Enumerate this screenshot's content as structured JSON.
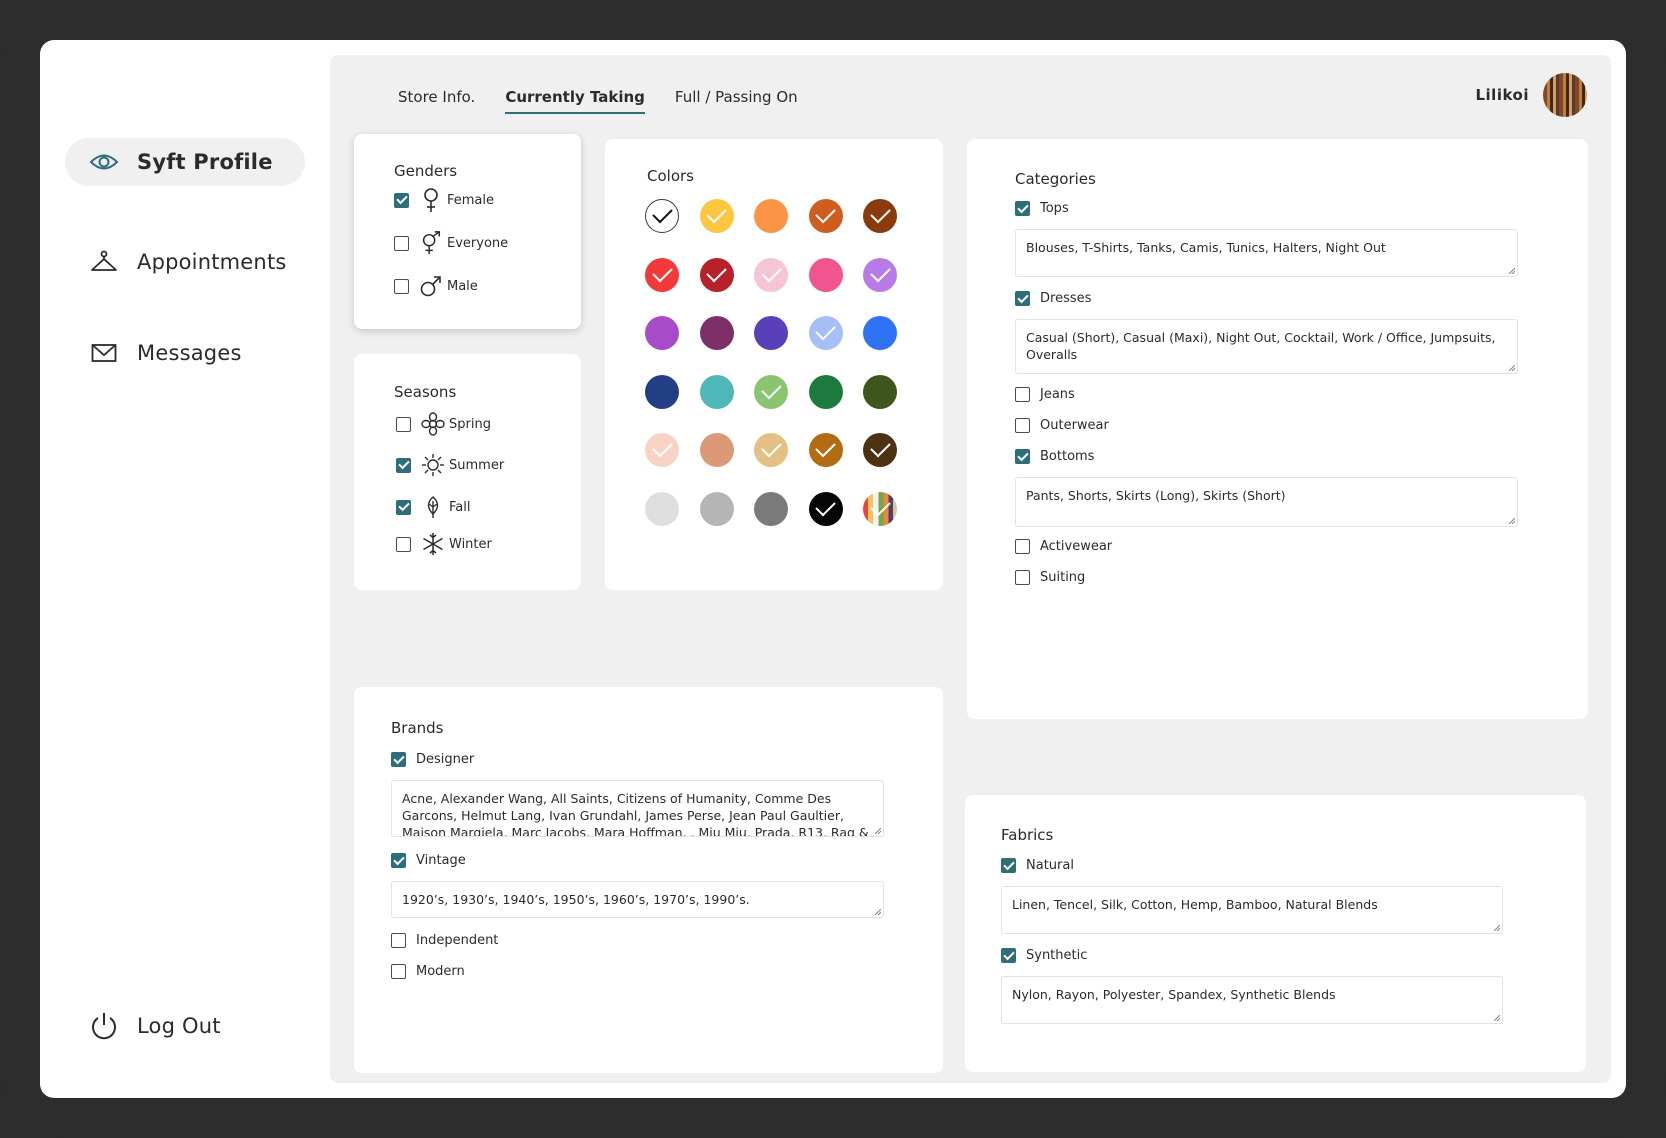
{
  "sidebar": {
    "items": [
      {
        "label": "Syft Profile",
        "icon": "eye-icon",
        "active": true
      },
      {
        "label": "Appointments",
        "icon": "hanger-icon",
        "active": false
      },
      {
        "label": "Messages",
        "icon": "envelope-icon",
        "active": false
      }
    ],
    "logout": {
      "label": "Log Out",
      "icon": "power-icon"
    }
  },
  "tabs": [
    {
      "label": "Store Info.",
      "active": false
    },
    {
      "label": "Currently Taking",
      "active": true
    },
    {
      "label": "Full / Passing On",
      "active": false
    }
  ],
  "user": {
    "name": "Lilikoi"
  },
  "genders": {
    "title": "Genders",
    "items": [
      {
        "label": "Female",
        "icon": "female-symbol-icon",
        "checked": true
      },
      {
        "label": "Everyone",
        "icon": "unisex-symbol-icon",
        "checked": false
      },
      {
        "label": "Male",
        "icon": "male-symbol-icon",
        "checked": false
      }
    ]
  },
  "seasons": {
    "title": "Seasons",
    "items": [
      {
        "label": "Spring",
        "icon": "flower-icon",
        "checked": false
      },
      {
        "label": "Summer",
        "icon": "sun-icon",
        "checked": true
      },
      {
        "label": "Fall",
        "icon": "leaf-icon",
        "checked": true
      },
      {
        "label": "Winter",
        "icon": "snowflake-icon",
        "checked": false
      }
    ]
  },
  "colors": {
    "title": "Colors",
    "swatches": [
      {
        "color": "#ffffff",
        "checked": true,
        "check_color": "#111111"
      },
      {
        "color": "#fcc740",
        "checked": true
      },
      {
        "color": "#fd9445",
        "checked": false
      },
      {
        "color": "#cf5d1f",
        "checked": true
      },
      {
        "color": "#8a3b0c",
        "checked": true
      },
      {
        "color": "#f23a3a",
        "checked": true
      },
      {
        "color": "#b8202a",
        "checked": true
      },
      {
        "color": "#f6c5d4",
        "checked": true
      },
      {
        "color": "#f2548f",
        "checked": false
      },
      {
        "color": "#b77ae6",
        "checked": true
      },
      {
        "color": "#a74bc9",
        "checked": false
      },
      {
        "color": "#7d3067",
        "checked": false
      },
      {
        "color": "#5a40b8",
        "checked": false
      },
      {
        "color": "#a6bff9",
        "checked": true
      },
      {
        "color": "#2f72f4",
        "checked": false
      },
      {
        "color": "#223f86",
        "checked": false
      },
      {
        "color": "#50b7b8",
        "checked": false
      },
      {
        "color": "#8ac46e",
        "checked": true
      },
      {
        "color": "#1d7a3f",
        "checked": false
      },
      {
        "color": "#3e561b",
        "checked": false
      },
      {
        "color": "#f8d3c5",
        "checked": true
      },
      {
        "color": "#dc9977",
        "checked": false
      },
      {
        "color": "#e3c184",
        "checked": true
      },
      {
        "color": "#b26c12",
        "checked": true
      },
      {
        "color": "#4c3212",
        "checked": true
      },
      {
        "color": "#dedede",
        "checked": false
      },
      {
        "color": "#b5b5b5",
        "checked": false
      },
      {
        "color": "#7a7a7a",
        "checked": false
      },
      {
        "color": "#050505",
        "checked": true
      },
      {
        "color": "multicolor",
        "checked": true
      }
    ]
  },
  "categories": {
    "title": "Categories",
    "items": [
      {
        "label": "Tops",
        "checked": true,
        "details": "Blouses, T-Shirts, Tanks, Camis, Tunics, Halters, Night Out"
      },
      {
        "label": "Dresses",
        "checked": true,
        "details": "Casual (Short), Casual (Maxi), Night Out, Cocktail, Work / Office, Jumpsuits, Overalls"
      },
      {
        "label": "Jeans",
        "checked": false
      },
      {
        "label": "Outerwear",
        "checked": false
      },
      {
        "label": "Bottoms",
        "checked": true,
        "details": "Pants, Shorts, Skirts (Long), Skirts (Short)"
      },
      {
        "label": "Activewear",
        "checked": false
      },
      {
        "label": "Suiting",
        "checked": false
      }
    ]
  },
  "brands": {
    "title": "Brands",
    "items": [
      {
        "label": "Designer",
        "checked": true,
        "details": "Acne, Alexander Wang,  All Saints,  Citizens of Humanity, Comme Des Garcons, Helmut Lang, Ivan Grundahl, James Perse, Jean Paul Gaultier, Maison Margiela, Marc Jacobs, Mara Hoffman, , Miu Miu, Prada, R13, Rag &"
      },
      {
        "label": "Vintage",
        "checked": true,
        "details": "1920’s, 1930’s, 1940’s, 1950’s, 1960’s, 1970’s, 1990’s."
      },
      {
        "label": "Independent",
        "checked": false
      },
      {
        "label": "Modern",
        "checked": false
      }
    ]
  },
  "fabrics": {
    "title": "Fabrics",
    "items": [
      {
        "label": "Natural",
        "checked": true,
        "details": "Linen, Tencel, Silk, Cotton, Hemp, Bamboo, Natural Blends"
      },
      {
        "label": "Synthetic",
        "checked": true,
        "details": "Nylon, Rayon, Polyester, Spandex, Synthetic Blends"
      }
    ]
  }
}
